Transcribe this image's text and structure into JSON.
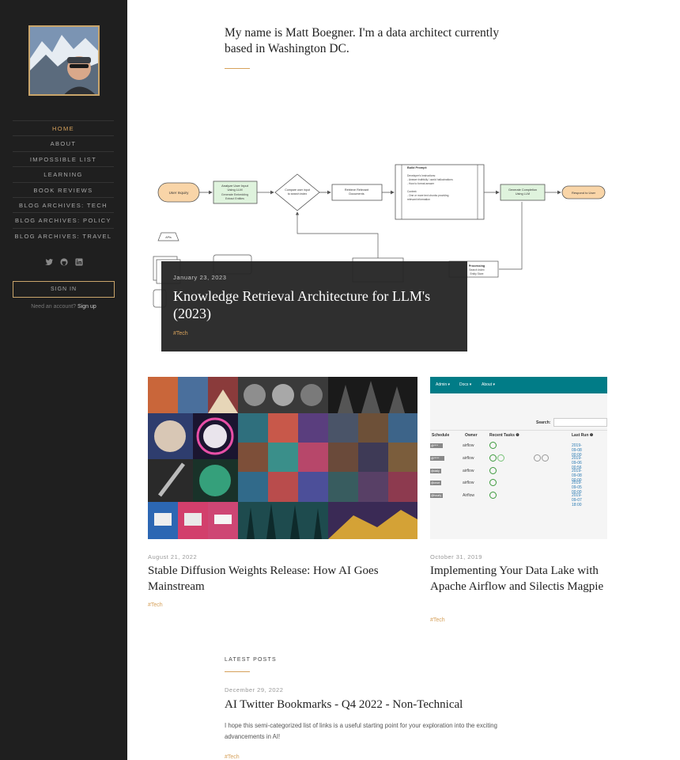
{
  "sidebar": {
    "nav": [
      {
        "label": "Home",
        "active": true
      },
      {
        "label": "About",
        "active": false
      },
      {
        "label": "Impossible List",
        "active": false
      },
      {
        "label": "Learning",
        "active": false
      },
      {
        "label": "Book Reviews",
        "active": false
      },
      {
        "label": "Blog Archives: Tech",
        "active": false
      },
      {
        "label": "Blog Archives: Policy",
        "active": false
      },
      {
        "label": "Blog Archives: Travel",
        "active": false
      }
    ],
    "social_icons": [
      "twitter-icon",
      "github-icon",
      "linkedin-icon"
    ],
    "signin_label": "Sign in",
    "account_prompt": "Need an account?",
    "signup_label": "Sign up"
  },
  "intro": {
    "text": "My name is Matt Boegner. I'm a data architect currently based in Washington DC."
  },
  "hero_diagram": {
    "nodes": {
      "user_inquiry": "User Inquiry",
      "analyze_1": "Analyze User Input",
      "analyze_2": "Using LLM",
      "analyze_3": "Generate Embedding",
      "analyze_4": "Extract Entities",
      "compare_1": "Compare user input",
      "compare_2": "to search index",
      "retrieve_1": "Retrieve Relevant",
      "retrieve_2": "Documents",
      "prompt_title": "Build Prompt:",
      "prompt_1": "Developer's Instructions:",
      "prompt_2": "- Answer truthfully / avoid hallucinations",
      "prompt_3": "- How to format answer",
      "prompt_4": "Context:",
      "prompt_5": "- One or more text chunks providing",
      "prompt_6": "relevant information",
      "generate_1": "Generate Completion",
      "generate_2": "Using LLM",
      "respond": "Respond to User",
      "apis": "APIs",
      "processing_1": "Processing",
      "processing_2": "Search Index",
      "processing_3": "Entity Store"
    }
  },
  "hero_post": {
    "date": "January 23, 2023",
    "title": "Knowledge Retrieval Architecture for LLM's (2023)",
    "tag": "#Tech"
  },
  "posts": [
    {
      "date": "August 21, 2022",
      "title": "Stable Diffusion Weights Release: How AI Goes Mainstream",
      "tag": "#Tech"
    },
    {
      "date": "October 31, 2019",
      "title": "Implementing Your Data Lake with Apache Airflow and Silectis Magpie",
      "tag": "#Tech"
    }
  ],
  "airflow_screenshot": {
    "menu": [
      "Admin ▾",
      "Docs ▾",
      "About ▾"
    ],
    "search_label": "Search:",
    "columns": [
      "Schedule",
      "Owner",
      "Recent Tasks ❶",
      "Last Run ❶"
    ],
    "rows": [
      {
        "schedule": "@****",
        "owner": "airflow",
        "last_run": "2019-09-08 00:00"
      },
      {
        "schedule": "@*****",
        "owner": "airflow",
        "last_run": "2019-09-06 00:56"
      },
      {
        "schedule": "@daily",
        "owner": "airflow",
        "last_run": "2019-09-08 00:00"
      },
      {
        "schedule": "@once",
        "owner": "airflow",
        "last_run": "2019-09-05 00:00"
      },
      {
        "schedule": "@hourly",
        "owner": "Airflow",
        "last_run": "2019-09-07 18:00"
      }
    ]
  },
  "latest": {
    "heading": "Latest Posts",
    "date": "December 29, 2022",
    "title": "AI Twitter Bookmarks - Q4 2022 - Non-Technical",
    "excerpt": "I hope this semi-categorized list of links is a useful starting point for your exploration into the exciting advancements in AI!",
    "tag": "#Tech"
  },
  "colors": {
    "sidebar_bg": "#1f1f1f",
    "accent": "#d6a15b",
    "card_overlay": "#242424"
  }
}
